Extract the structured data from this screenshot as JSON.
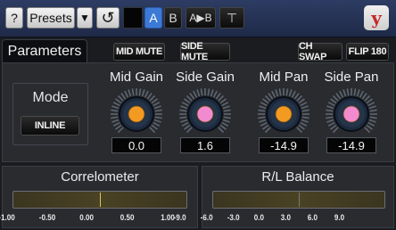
{
  "toolbar": {
    "help_label": "?",
    "presets_label": "Presets",
    "dropdown_glyph": "▼",
    "reset_glyph": "↺",
    "a_label": "A",
    "b_label": "B",
    "copy_label": "A▶B",
    "window_glyph": "⊤",
    "logo_text": "y",
    "logo_color": "#c82828"
  },
  "tab": {
    "label": "Parameters"
  },
  "buttons": {
    "mid_mute": "MID MUTE",
    "side_mute": "SIDE MUTE",
    "ch_swap": "CH SWAP",
    "flip_180": "FLIP 180"
  },
  "mode": {
    "label": "Mode",
    "value": "INLINE"
  },
  "knobs": [
    {
      "label": "Mid Gain",
      "value": "0.0",
      "color": "#f29a22"
    },
    {
      "label": "Side Gain",
      "value": "1.6",
      "color": "#f28ad0"
    },
    {
      "label": "Mid Pan",
      "value": "-14.9",
      "color": "#f29a22"
    },
    {
      "label": "Side Pan",
      "value": "-14.9",
      "color": "#f28ad0"
    }
  ],
  "correlometer": {
    "title": "Correlometer",
    "scale": [
      "-1.00",
      "-0.50",
      "0.00",
      "0.50",
      "1.00"
    ],
    "value": 0.0
  },
  "balance": {
    "title": "R/L Balance",
    "scale": [
      "-9.0",
      "-6.0",
      "-3.0",
      "0.0",
      "3.0",
      "6.0",
      "9.0"
    ],
    "value": 0.0
  }
}
